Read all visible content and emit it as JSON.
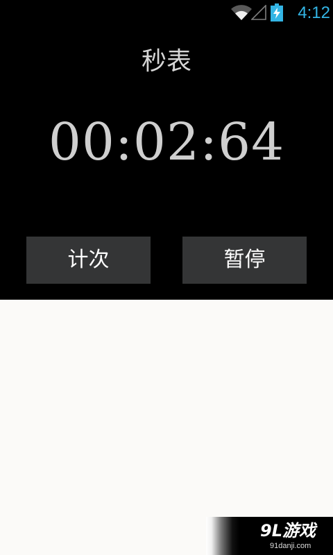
{
  "status_bar": {
    "time": "4:12",
    "accent_color": "#33b5e5",
    "icons": [
      "wifi-icon",
      "signal-icon",
      "battery-charging-icon"
    ]
  },
  "stopwatch": {
    "title": "秒表",
    "elapsed": "00:02:64",
    "lap_label": "计次",
    "pause_label": "暂停"
  },
  "watermark": {
    "logo": "9L游戏",
    "url": "91danji.com"
  }
}
